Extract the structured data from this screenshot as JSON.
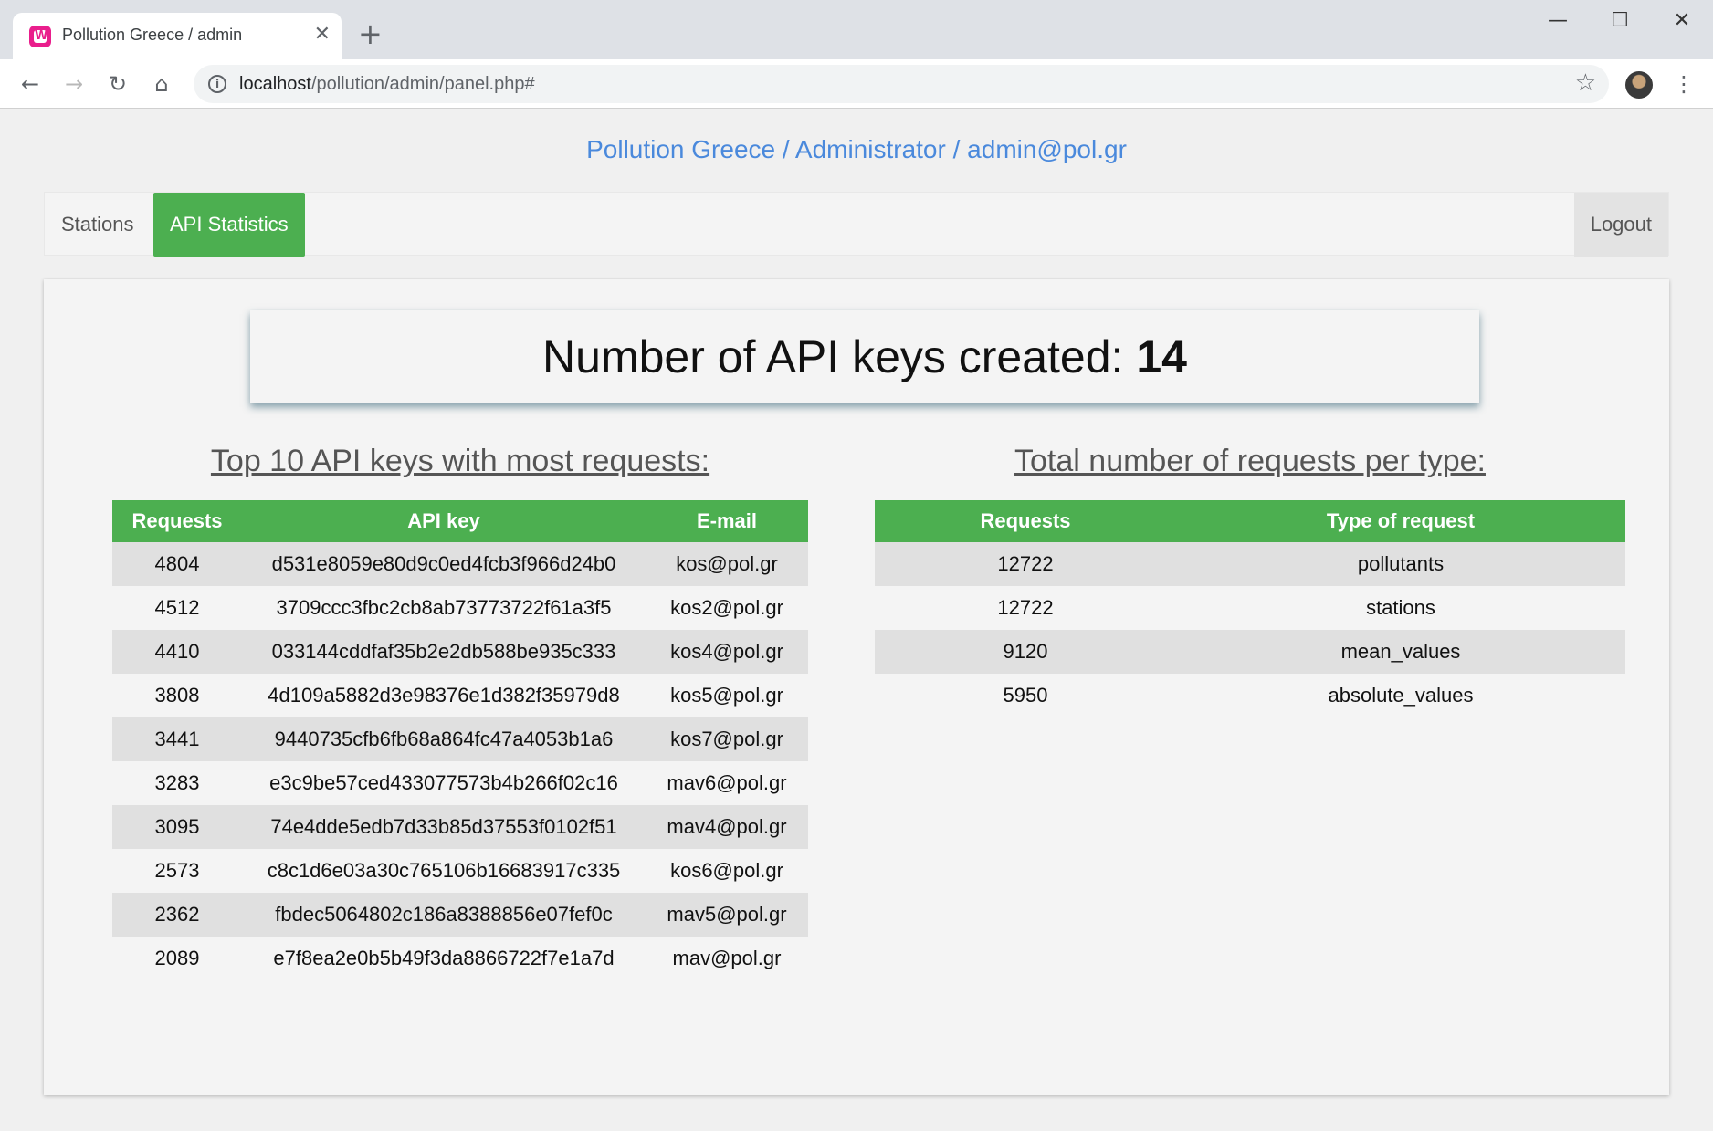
{
  "browser": {
    "tab_title": "Pollution Greece / admin",
    "tab_close_glyph": "✕",
    "new_tab_glyph": "+",
    "url_host": "localhost",
    "url_path": "/pollution/admin/panel.php#",
    "window_controls": {
      "minimize": "—",
      "maximize": "☐",
      "close": "✕"
    },
    "icons": [
      "back-icon",
      "forward-icon",
      "reload-icon",
      "home-icon",
      "info-icon",
      "star-icon",
      "profile-avatar",
      "menu-icon"
    ]
  },
  "header": {
    "brand": "Pollution Greece / Administrator / admin@pol.gr"
  },
  "nav": {
    "stations": "Stations",
    "api_statistics": "API Statistics",
    "logout": "Logout",
    "active": "API Statistics",
    "accent_color": "#4caf50"
  },
  "kpi": {
    "label": "Number of API keys created: ",
    "value": "14"
  },
  "top_keys": {
    "title": "Top 10 API keys with most requests:",
    "headers": [
      "Requests",
      "API key",
      "E-mail"
    ],
    "rows": [
      [
        "4804",
        "d531e8059e80d9c0ed4fcb3f966d24b0",
        "kos@pol.gr"
      ],
      [
        "4512",
        "3709ccc3fbc2cb8ab73773722f61a3f5",
        "kos2@pol.gr"
      ],
      [
        "4410",
        "033144cddfaf35b2e2db588be935c333",
        "kos4@pol.gr"
      ],
      [
        "3808",
        "4d109a5882d3e98376e1d382f35979d8",
        "kos5@pol.gr"
      ],
      [
        "3441",
        "9440735cfb6fb68a864fc47a4053b1a6",
        "kos7@pol.gr"
      ],
      [
        "3283",
        "e3c9be57ced433077573b4b266f02c16",
        "mav6@pol.gr"
      ],
      [
        "3095",
        "74e4dde5edb7d33b85d37553f0102f51",
        "mav4@pol.gr"
      ],
      [
        "2573",
        "c8c1d6e03a30c765106b16683917c335",
        "kos6@pol.gr"
      ],
      [
        "2362",
        "fbdec5064802c186a8388856e07fef0c",
        "mav5@pol.gr"
      ],
      [
        "2089",
        "e7f8ea2e0b5b49f3da8866722f7e1a7d",
        "mav@pol.gr"
      ]
    ]
  },
  "request_types": {
    "title": "Total number of requests per type:",
    "headers": [
      "Requests",
      "Type of request"
    ],
    "rows": [
      [
        "12722",
        "pollutants"
      ],
      [
        "12722",
        "stations"
      ],
      [
        "9120",
        "mean_values"
      ],
      [
        "5950",
        "absolute_values"
      ]
    ]
  }
}
